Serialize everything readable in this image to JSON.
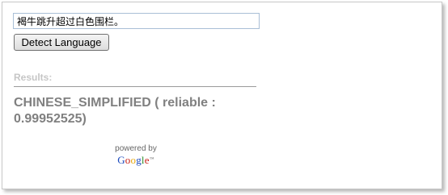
{
  "input": {
    "value": "褐牛跳升超过白色围栏。"
  },
  "button": {
    "label": "Detect Language"
  },
  "results": {
    "label": "Results:",
    "text": "CHINESE_SIMPLIFIED ( reliable : 0.99952525)"
  },
  "attribution": {
    "powered_by": "powered by",
    "logo_letters": [
      "G",
      "o",
      "o",
      "g",
      "l",
      "e"
    ],
    "trademark": "™"
  },
  "colors": {
    "results_label": "#c6c6c6",
    "result_text": "#808080",
    "google_blue": "#1a48bd",
    "google_red": "#c9231a",
    "google_yellow": "#e7a80f",
    "google_green": "#2e8f2b"
  }
}
